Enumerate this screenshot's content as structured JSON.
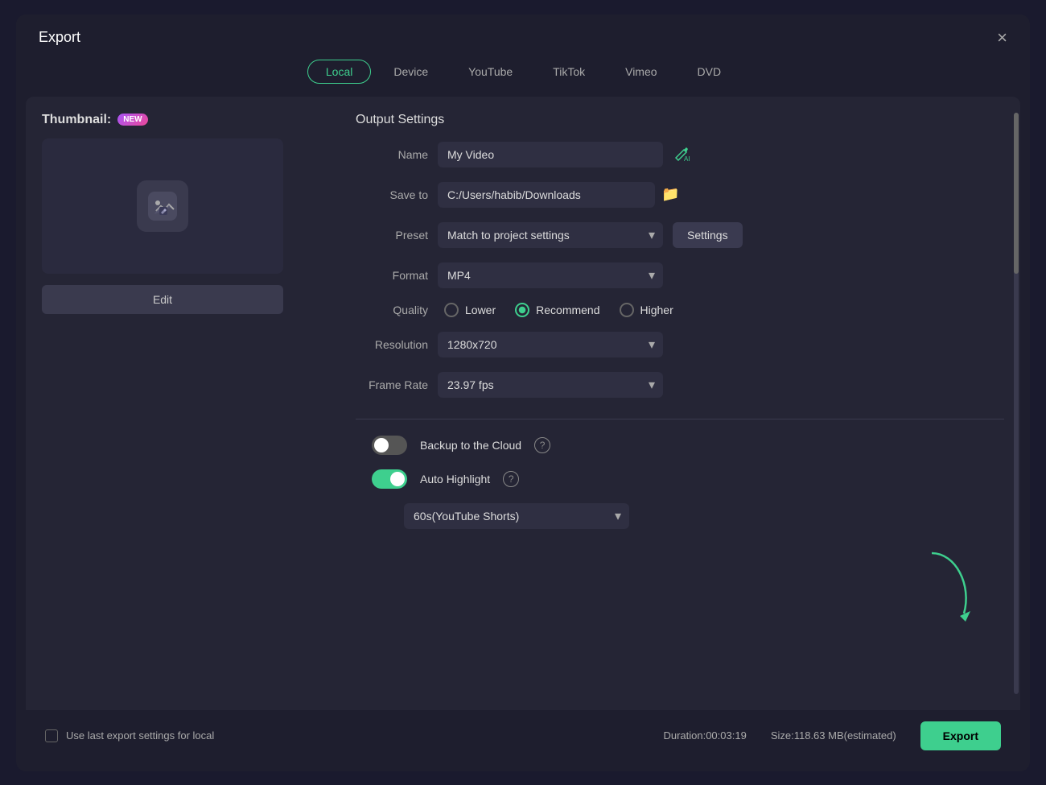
{
  "dialog": {
    "title": "Export",
    "close_label": "×"
  },
  "tabs": {
    "items": [
      {
        "label": "Local",
        "active": true
      },
      {
        "label": "Device",
        "active": false
      },
      {
        "label": "YouTube",
        "active": false
      },
      {
        "label": "TikTok",
        "active": false
      },
      {
        "label": "Vimeo",
        "active": false
      },
      {
        "label": "DVD",
        "active": false
      }
    ]
  },
  "thumbnail": {
    "label": "Thumbnail:",
    "badge": "NEW",
    "edit_button": "Edit"
  },
  "output_settings": {
    "title": "Output Settings",
    "name_label": "Name",
    "name_value": "My Video",
    "save_to_label": "Save to",
    "save_to_value": "C:/Users/habib/Downloads",
    "preset_label": "Preset",
    "preset_value": "Match to project settings",
    "settings_button": "Settings",
    "format_label": "Format",
    "format_value": "MP4",
    "quality_label": "Quality",
    "quality_options": [
      {
        "label": "Lower",
        "value": "lower",
        "checked": false
      },
      {
        "label": "Recommend",
        "value": "recommend",
        "checked": true
      },
      {
        "label": "Higher",
        "value": "higher",
        "checked": false
      }
    ],
    "resolution_label": "Resolution",
    "resolution_value": "1280x720",
    "framerate_label": "Frame Rate",
    "framerate_value": "23.97 fps",
    "backup_label": "Backup to the Cloud",
    "backup_checked": false,
    "autohighlight_label": "Auto Highlight",
    "autohighlight_checked": true,
    "duration_dropdown": "60s(YouTube Shorts)"
  },
  "footer": {
    "use_last_label": "Use last export settings for local",
    "duration_label": "Duration:",
    "duration_value": "00:03:19",
    "size_label": "Size:",
    "size_value": "118.63 MB(estimated)",
    "export_button": "Export"
  }
}
